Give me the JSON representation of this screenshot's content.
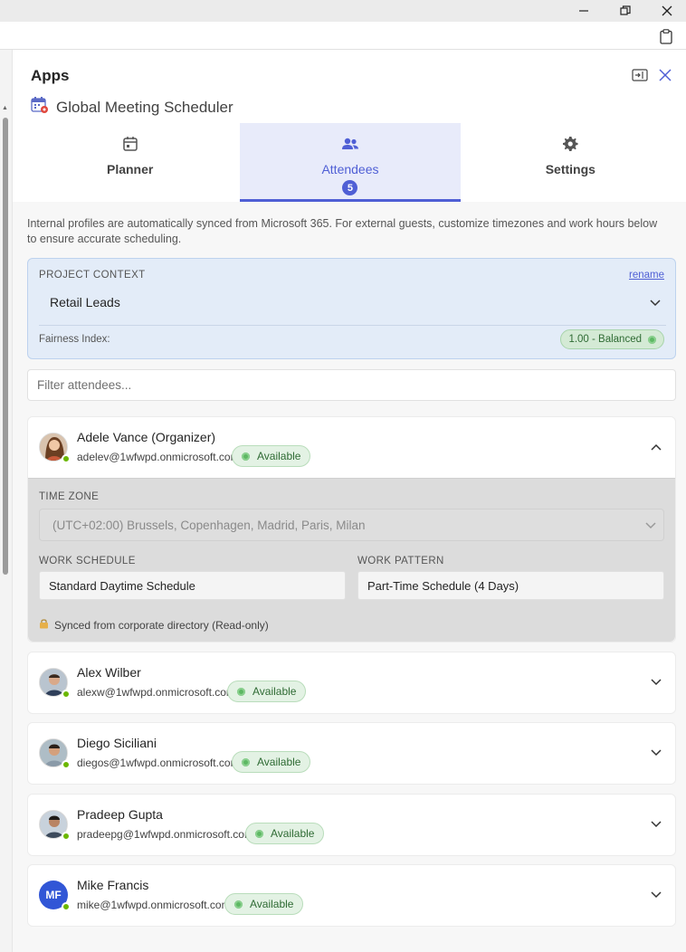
{
  "window": {
    "minimize_icon": "minimize-icon",
    "restore_icon": "restore-icon",
    "close_icon": "close-icon"
  },
  "toolbar": {
    "clipboard_icon": "clipboard-icon"
  },
  "panel": {
    "title": "Apps",
    "app_name": "Global Meeting Scheduler"
  },
  "tabs": [
    {
      "label": "Planner",
      "icon": "calendar-icon"
    },
    {
      "label": "Attendees",
      "icon": "people-icon",
      "badge": "5"
    },
    {
      "label": "Settings",
      "icon": "gear-icon"
    }
  ],
  "info": "Internal profiles are automatically synced from Microsoft 365. For external guests, customize timezones and work hours below to ensure accurate scheduling.",
  "project": {
    "label": "PROJECT CONTEXT",
    "rename": "rename",
    "selected": "Retail Leads",
    "fairness_label": "Fairness Index:",
    "fairness_value": "1.00 - Balanced"
  },
  "filter": {
    "placeholder": "Filter attendees..."
  },
  "attendees": [
    {
      "name": "Adele Vance (Organizer)",
      "email": "adelev@1wfwpd.onmicrosoft.com",
      "status": "Available",
      "expanded": true
    },
    {
      "name": "Alex Wilber",
      "email": "alexw@1wfwpd.onmicrosoft.com",
      "status": "Available"
    },
    {
      "name": "Diego Siciliani",
      "email": "diegos@1wfwpd.onmicrosoft.com",
      "status": "Available"
    },
    {
      "name": "Pradeep Gupta",
      "email": "pradeepg@1wfwpd.onmicrosoft.com",
      "status": "Available"
    },
    {
      "name": "Mike Francis",
      "email": "mike@1wfwpd.onmicrosoft.com",
      "status": "Available",
      "initials": "MF"
    }
  ],
  "details": {
    "timezone_label": "TIME ZONE",
    "timezone_value": "(UTC+02:00) Brussels, Copenhagen, Madrid, Paris, Milan",
    "schedule_label": "WORK SCHEDULE",
    "schedule_value": "Standard Daytime Schedule",
    "pattern_label": "WORK PATTERN",
    "pattern_value": "Part-Time Schedule (4 Days)",
    "synced_note": "Synced from corporate directory (Read-only)"
  },
  "colors": {
    "accent": "#4f5fd5",
    "available": "#5db863",
    "context_bg": "#e3ecf8"
  }
}
